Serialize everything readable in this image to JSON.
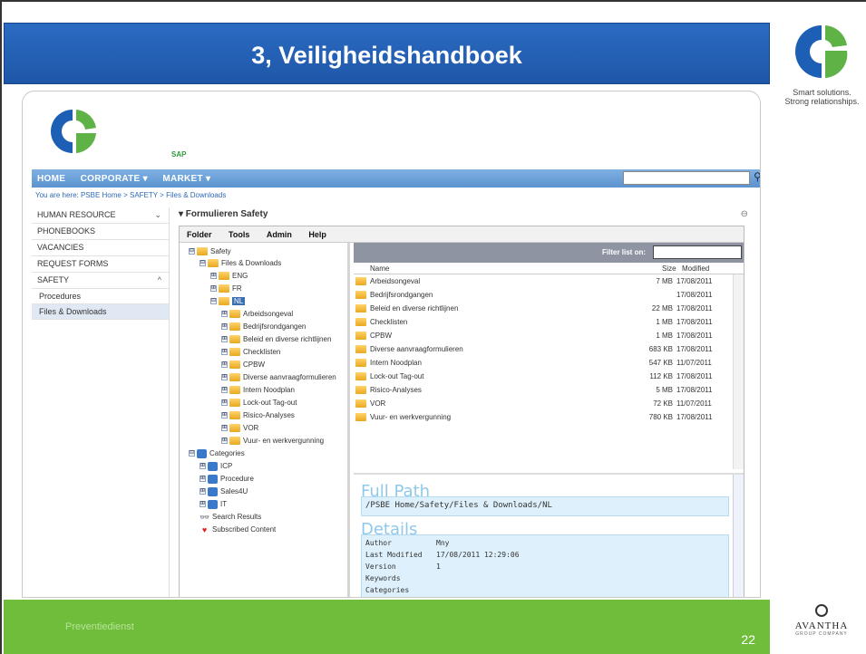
{
  "slide": {
    "title": "3, Veiligheidshandboek",
    "tagline_1": "Smart solutions.",
    "tagline_2": "Strong relationships.",
    "footer_left": "Preventiedienst",
    "page_number": "22",
    "brand": "AVANTHA",
    "brand_sub": "GROUP COMPANY"
  },
  "colors": {
    "title_blue": "#1f57a8",
    "footer_green": "#6fbd3a",
    "nav_blue": "#5b93cf"
  },
  "portal": {
    "sap": "SAP",
    "nav": [
      "HOME",
      "CORPORATE ▾",
      "MARKET ▾"
    ],
    "search_flag": "▾",
    "breadcrumb": "You are here:  PSBE Home > SAFETY > Files & Downloads",
    "left_nav": [
      {
        "label": "HUMAN RESOURCE",
        "chev": "⌄"
      },
      {
        "label": "PHONEBOOKS",
        "chev": ""
      },
      {
        "label": "VACANCIES",
        "chev": ""
      },
      {
        "label": "REQUEST FORMS",
        "chev": ""
      },
      {
        "label": "SAFETY",
        "chev": "^"
      }
    ],
    "left_sub": [
      "Procedures",
      "Files & Downloads"
    ],
    "panel_title": "▾ Formulieren Safety",
    "panel_min": "⊖"
  },
  "explorer": {
    "menu": [
      "Folder",
      "Tools",
      "Admin",
      "Help"
    ],
    "tree": [
      {
        "label": "Safety",
        "exp": "⊟"
      },
      {
        "label": "Files & Downloads",
        "exp": "⊟"
      },
      {
        "label": "ENG",
        "exp": "⊞"
      },
      {
        "label": "FR",
        "exp": "⊞"
      },
      {
        "label": "NL",
        "exp": "⊟"
      },
      {
        "label": "Arbeidsongeval",
        "exp": "⊞"
      },
      {
        "label": "Bedrijfsrondgangen",
        "exp": "⊞"
      },
      {
        "label": "Beleid en diverse richtlijnen",
        "exp": "⊞"
      },
      {
        "label": "Checklisten",
        "exp": "⊞"
      },
      {
        "label": "CPBW",
        "exp": "⊞"
      },
      {
        "label": "Diverse aanvraagformulieren",
        "exp": "⊞"
      },
      {
        "label": "Intern Noodplan",
        "exp": "⊞"
      },
      {
        "label": "Lock-out Tag-out",
        "exp": "⊞"
      },
      {
        "label": "Risico-Analyses",
        "exp": "⊞"
      },
      {
        "label": "VOR",
        "exp": "⊞"
      },
      {
        "label": "Vuur- en werkvergunning",
        "exp": "⊞"
      },
      {
        "label": "Categories",
        "exp": "⊟"
      },
      {
        "label": "ICP",
        "exp": "⊞"
      },
      {
        "label": "Procedure",
        "exp": "⊞"
      },
      {
        "label": "Sales4U",
        "exp": "⊞"
      },
      {
        "label": "IT",
        "exp": "⊞"
      },
      {
        "label": "Search Results",
        "exp": ""
      },
      {
        "label": "Subscribed Content",
        "exp": ""
      }
    ],
    "filter_label": "Filter list on:",
    "columns": {
      "name": "Name",
      "size": "Size",
      "modified": "Modified"
    },
    "rows": [
      {
        "name": "Arbeidsongeval",
        "size": "7 MB",
        "modified": "17/08/2011"
      },
      {
        "name": "Bedrijfsrondgangen",
        "size": "",
        "modified": "17/08/2011"
      },
      {
        "name": "Beleid en diverse richtlijnen",
        "size": "22 MB",
        "modified": "17/08/2011"
      },
      {
        "name": "Checklisten",
        "size": "1 MB",
        "modified": "17/08/2011"
      },
      {
        "name": "CPBW",
        "size": "1 MB",
        "modified": "17/08/2011"
      },
      {
        "name": "Diverse aanvraagformulieren",
        "size": "683 KB",
        "modified": "17/08/2011"
      },
      {
        "name": "Intern Noodplan",
        "size": "547 KB",
        "modified": "11/07/2011"
      },
      {
        "name": "Lock-out Tag-out",
        "size": "112 KB",
        "modified": "17/08/2011"
      },
      {
        "name": "Risico-Analyses",
        "size": "5 MB",
        "modified": "17/08/2011"
      },
      {
        "name": "VOR",
        "size": "72 KB",
        "modified": "11/07/2011"
      },
      {
        "name": "Vuur- en werkvergunning",
        "size": "780 KB",
        "modified": "17/08/2011"
      }
    ],
    "full_path_label": "Full Path",
    "full_path": "/PSBE Home/Safety/Files & Downloads/NL",
    "details_label": "Details",
    "details": [
      {
        "k": "Author",
        "v": "Mny"
      },
      {
        "k": "Last Modified",
        "v": "17/08/2011 12:29:06"
      },
      {
        "k": "Version",
        "v": "1"
      },
      {
        "k": "Keywords",
        "v": ""
      },
      {
        "k": "Categories",
        "v": ""
      }
    ]
  }
}
